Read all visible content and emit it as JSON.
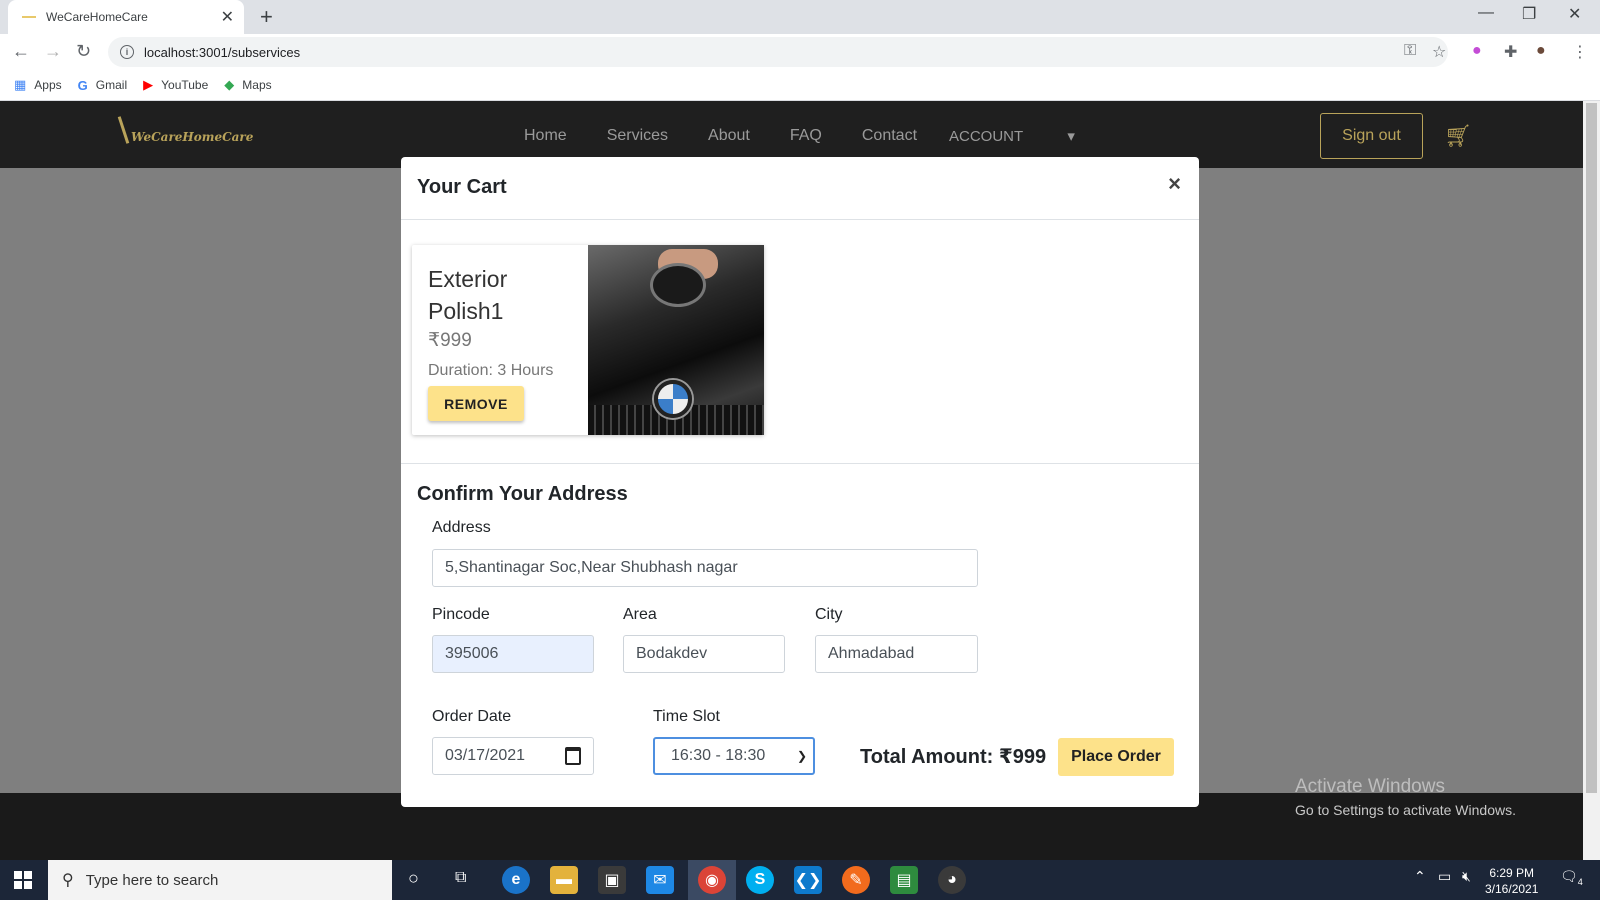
{
  "browser": {
    "tab_title": "WeCareHomeCare",
    "url": "localhost:3001/subservices",
    "bookmarks": [
      "Apps",
      "Gmail",
      "YouTube",
      "Maps"
    ]
  },
  "site": {
    "logo": "WeCareHomeCare",
    "nav": [
      "Home",
      "Services",
      "About",
      "FAQ",
      "Contact"
    ],
    "account_label": "ACCOUNT",
    "sign_out": "Sign out"
  },
  "modal": {
    "title": "Your Cart",
    "close": "×",
    "item": {
      "name": "Exterior Polish1",
      "price": "₹999",
      "duration": "Duration: 3 Hours",
      "remove_label": "REMOVE"
    },
    "address_section": {
      "title": "Confirm Your Address",
      "address_label": "Address",
      "address_value": "5,Shantinagar Soc,Near Shubhash nagar",
      "pincode_label": "Pincode",
      "pincode_value": "395006",
      "area_label": "Area",
      "area_value": "Bodakdev",
      "city_label": "City",
      "city_value": "Ahmadabad",
      "date_label": "Order Date",
      "date_value": "03/17/2021",
      "slot_label": "Time Slot",
      "slot_value": "16:30 - 18:30",
      "total": "Total Amount: ₹999",
      "place_order": "Place Order"
    }
  },
  "watermark": {
    "line1": "Activate Windows",
    "line2": "Go to Settings to activate Windows."
  },
  "taskbar": {
    "search_placeholder": "Type here to search",
    "time": "6:29 PM",
    "date": "3/16/2021",
    "notification_count": "4"
  },
  "colors": {
    "accent_gold": "#b9a35a",
    "button_yellow": "#fde28a"
  }
}
